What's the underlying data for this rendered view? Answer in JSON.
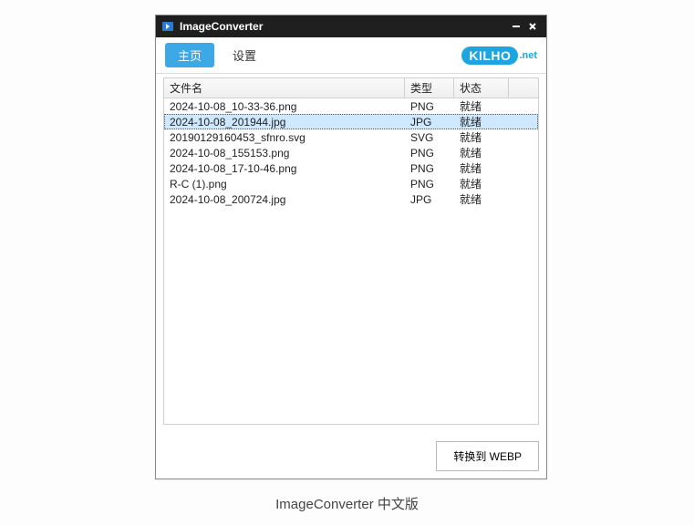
{
  "window": {
    "title": "ImageConverter"
  },
  "tabs": {
    "home": "主页",
    "settings": "设置"
  },
  "logo": {
    "main": "KILHO",
    "suffix": ".net"
  },
  "table": {
    "headers": {
      "filename": "文件名",
      "type": "类型",
      "status": "状态"
    },
    "rows": [
      {
        "filename": "2024-10-08_10-33-36.png",
        "type": "PNG",
        "status": "就绪",
        "selected": false
      },
      {
        "filename": "2024-10-08_201944.jpg",
        "type": "JPG",
        "status": "就绪",
        "selected": true
      },
      {
        "filename": "20190129160453_sfnro.svg",
        "type": "SVG",
        "status": "就绪",
        "selected": false
      },
      {
        "filename": "2024-10-08_155153.png",
        "type": "PNG",
        "status": "就绪",
        "selected": false
      },
      {
        "filename": "2024-10-08_17-10-46.png",
        "type": "PNG",
        "status": "就绪",
        "selected": false
      },
      {
        "filename": "R-C (1).png",
        "type": "PNG",
        "status": "就绪",
        "selected": false
      },
      {
        "filename": "2024-10-08_200724.jpg",
        "type": "JPG",
        "status": "就绪",
        "selected": false
      }
    ]
  },
  "footer": {
    "convert_label": "转换到 WEBP"
  },
  "caption": "ImageConverter 中文版"
}
